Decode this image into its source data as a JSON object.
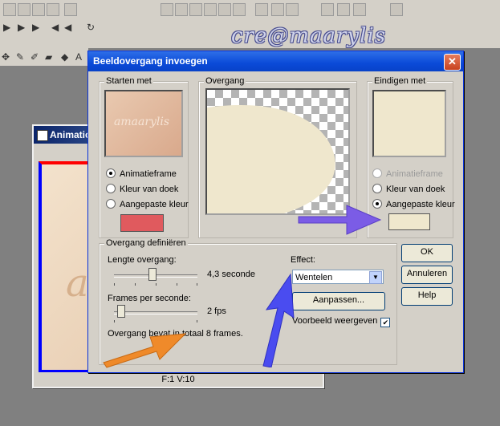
{
  "watermark": "cre@maarylis",
  "anim_window": {
    "title": "Animation",
    "status": "F:1  V:10",
    "canvas_text": "a"
  },
  "dialog": {
    "title": "Beeldovergang invoegen",
    "start_group": {
      "label": "Starten met",
      "preview_text": "amaarylis",
      "options": [
        "Animatieframe",
        "Kleur van doek",
        "Aangepaste kleur"
      ],
      "selected": 0,
      "custom_color": "#e05a5e"
    },
    "transition_group": {
      "label": "Overgang"
    },
    "end_group": {
      "label": "Eindigen met",
      "options": [
        "Animatieframe",
        "Kleur van doek",
        "Aangepaste kleur"
      ],
      "selected": 2,
      "custom_color": "#efe7cd"
    },
    "define_group": {
      "label": "Overgang definiëren",
      "length_label": "Lengte overgang:",
      "length_value": "4,3 seconde",
      "length_fraction": 0.45,
      "fps_label": "Frames per seconde:",
      "fps_value": "2 fps",
      "fps_fraction": 0.08,
      "total_text": "Overgang bevat in totaal 8 frames.",
      "effect_label": "Effect:",
      "effect_value": "Wentelen",
      "customize_label": "Aanpassen...",
      "preview_label": "Voorbeeld weergeven",
      "preview_checked": true
    },
    "buttons": {
      "ok": "OK",
      "cancel": "Annuleren",
      "help": "Help"
    }
  },
  "colors": {
    "accent": "#0a4ad8",
    "purple_arrow": "#7b5ce6",
    "orange_arrow": "#ef8a2a",
    "blue_arrow": "#4a4cf0",
    "cream": "#efe7cd"
  }
}
